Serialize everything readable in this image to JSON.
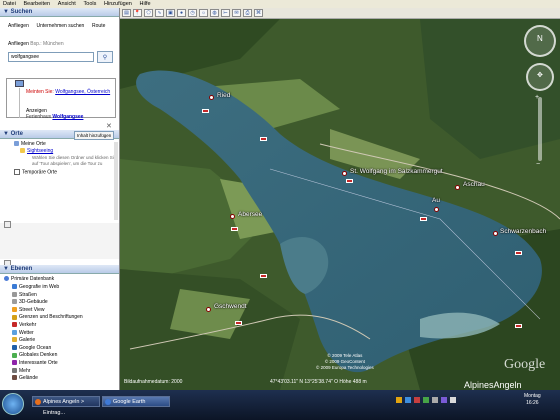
{
  "menu": [
    "Datei",
    "Bearbeiten",
    "Ansicht",
    "Tools",
    "Hinzufügen",
    "Hilfe"
  ],
  "search": {
    "header": "Suchen",
    "tabs": [
      "Anfliegen",
      "Unternehmen suchen",
      "Route"
    ],
    "prompt": "Anfliegen",
    "prompt_hint": "Bsp.: München",
    "query": "wolfgangsee",
    "meinten_prefix": "Meinten Sie:",
    "meinten_link": "Wolfgangsee, Österreich",
    "anzeigen": "Anzeigen",
    "result_prefix": "Ferienhaus",
    "result_link": "Wolfgangsee"
  },
  "places": {
    "header": "Orte",
    "add_button": "Inhalt hinzufügen",
    "meine_orte": "Meine Orte",
    "sightseeing": "Sightseeing",
    "hint_line1": "Wählen Sie diesen Ordner und klicken Sie",
    "hint_line2": "auf 'Tour abspielen', um die Tour zu",
    "temporaere": "Temporäre Orte"
  },
  "layers": {
    "header": "Ebenen",
    "primary": "Primäre Datenbank",
    "items": [
      {
        "label": "Geografie im Web",
        "color": "#3a7bd5"
      },
      {
        "label": "Straßen",
        "color": "#999999"
      },
      {
        "label": "3D-Gebäude",
        "color": "#9c9c9c"
      },
      {
        "label": "Street View",
        "color": "#f0a020"
      },
      {
        "label": "Grenzen und Beschriftungen",
        "color": "#d4a017"
      },
      {
        "label": "Verkehr",
        "color": "#c62828"
      },
      {
        "label": "Wetter",
        "color": "#5aa0e0"
      },
      {
        "label": "Galerie",
        "color": "#e0b030"
      },
      {
        "label": "Google Ocean",
        "color": "#1e5fa8"
      },
      {
        "label": "Globales Denken",
        "color": "#4caf50"
      },
      {
        "label": "Interessante Orte",
        "color": "#8e24aa"
      },
      {
        "label": "Mehr",
        "color": "#757575"
      },
      {
        "label": "Gelände",
        "color": "#6d4c41"
      }
    ]
  },
  "map": {
    "labels": {
      "ried": "Ried",
      "abersee": "Abersee",
      "gschwendt": "Gschwendt",
      "wolfgang": "St. Wolfgang im Salzkammergut",
      "aschau": "Aschau",
      "au": "Au",
      "schwarzenbach": "Schwarzenbach"
    },
    "imagery_date": "Bildaufnahmedatum: 2000",
    "coords": "47°43'03.11\" N  13°25'38.74\" O  Höhe 488 m",
    "copyright1": "© 2009 Tele Atlas",
    "copyright2": "© 2009 GeoContent",
    "copyright3": "© 2009 Europa Technologies",
    "logo": "Google",
    "watermark": "AlpinesAngeln"
  },
  "taskbar": {
    "items": [
      "Alpines Angeln > Eintrag...",
      "Google Earth"
    ],
    "clock_time": "Montag",
    "clock_date": "16:26"
  }
}
